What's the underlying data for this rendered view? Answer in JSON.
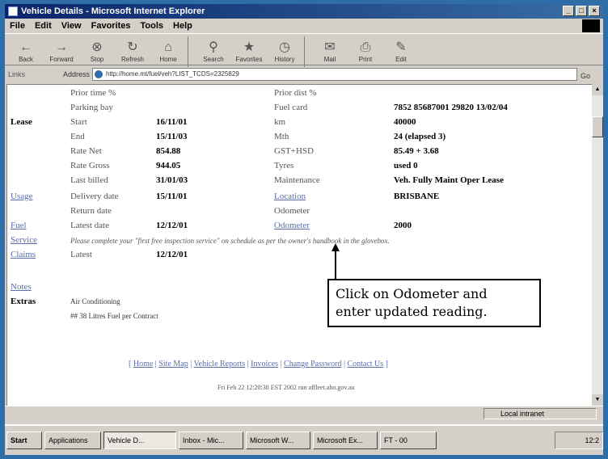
{
  "window": {
    "title": "Vehicle Details - Microsoft Internet Explorer"
  },
  "menu": [
    "File",
    "Edit",
    "View",
    "Favorites",
    "Tools",
    "Help"
  ],
  "toolbar": [
    {
      "label": "Back",
      "icon": "back-icon",
      "glyph": "←"
    },
    {
      "label": "Forward",
      "icon": "forward-icon",
      "glyph": "→"
    },
    {
      "label": "Stop",
      "icon": "stop-icon",
      "glyph": "⊗"
    },
    {
      "label": "Refresh",
      "icon": "refresh-icon",
      "glyph": "↻"
    },
    {
      "label": "Home",
      "icon": "home-icon",
      "glyph": "⌂"
    },
    {
      "label": "Search",
      "icon": "search-icon",
      "glyph": "⚲"
    },
    {
      "label": "Favorites",
      "icon": "favorites-icon",
      "glyph": "★"
    },
    {
      "label": "History",
      "icon": "history-icon",
      "glyph": "◷"
    },
    {
      "label": "Mail",
      "icon": "mail-icon",
      "glyph": "✉"
    },
    {
      "label": "Print",
      "icon": "print-icon",
      "glyph": "⎙"
    },
    {
      "label": "Edit",
      "icon": "edit-icon",
      "glyph": "✎"
    }
  ],
  "address": {
    "links_label": "Links",
    "label": "Address",
    "url": "http://home.mt/fuel/veh?LIST_TCDS=2325829",
    "go_label": "Go"
  },
  "rows": [
    {
      "section": "Lease",
      "section_type": "bold",
      "items": [
        [
          "Start",
          "16/11/01",
          "km",
          "40000"
        ],
        [
          "End",
          "15/11/03",
          "Mth",
          "24 (elapsed 3)"
        ],
        [
          "Rate Net",
          "854.88",
          "GST+HSD",
          "85.49 + 3.68"
        ],
        [
          "Rate Gross",
          "944.05",
          "Tyres",
          "used 0"
        ],
        [
          "Last billed",
          "31/01/03",
          "Maintenance",
          "Veh. Fully Maint Oper Lease"
        ]
      ]
    },
    {
      "section": "Usage",
      "section_type": "link",
      "items": [
        [
          "Delivery date",
          "15/11/01",
          "Location",
          "BRISBANE"
        ],
        [
          "Return date",
          "",
          "Odometer",
          ""
        ]
      ]
    },
    {
      "section": "Fuel",
      "section_type": "link",
      "items": [
        [
          "Latest date",
          "12/12/01",
          "Odometer",
          "2000"
        ]
      ]
    }
  ],
  "top": {
    "prior_time_label": "Prior time %",
    "prior_dist_label": "Prior dist %",
    "parking_bay_label": "Parking bay",
    "fuel_card_label": "Fuel card",
    "fuel_card_value": "7852 85687001 29820 13/02/04"
  },
  "service": {
    "label": "Service",
    "note": "Please complete your \"first free inspection service\" on schedule as per the owner's handbook in the glovebox."
  },
  "claims": {
    "label": "Claims",
    "latest_label": "Latest",
    "latest_value": "12/12/01"
  },
  "notes": {
    "label": "Notes"
  },
  "extras": {
    "label": "Extras",
    "items": [
      "Air Conditioning",
      "## 38 Litres Fuel per Contract"
    ]
  },
  "callout": {
    "line1": "Click on Odometer and",
    "line2": "enter updated reading."
  },
  "footer": {
    "links": [
      "Home",
      "Site Map",
      "Vehicle Reports",
      "Invoices",
      "Change Password",
      "Contact Us"
    ],
    "stamp": "Fri Feb 22 12:20:38 EST 2002 run affleet.aho.gov.au"
  },
  "status": {
    "zone": "Local intranet"
  },
  "taskbar": {
    "start": "Start",
    "items": [
      "Applications",
      "Vehicle D...",
      "Inbox - Mic...",
      "Microsoft W...",
      "Microsoft Ex...",
      "FT - 00"
    ],
    "clock": "12:2"
  }
}
